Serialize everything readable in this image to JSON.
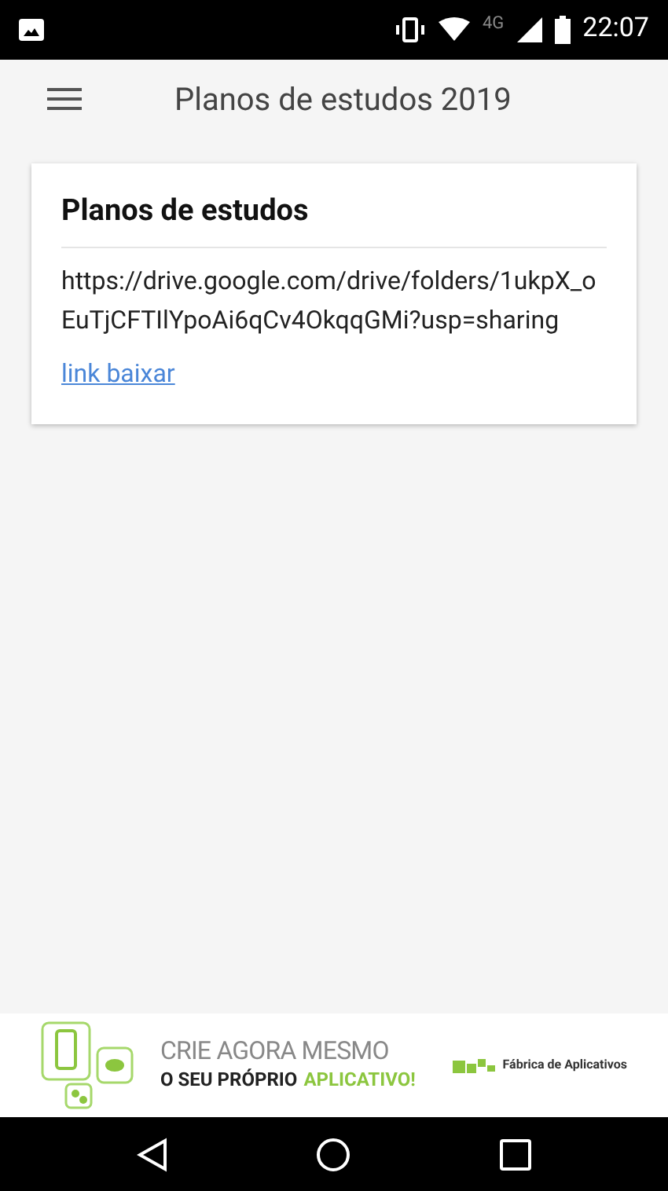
{
  "status_bar": {
    "network": "4G",
    "time": "22:07"
  },
  "app_bar": {
    "title": "Planos de estudos 2019"
  },
  "card": {
    "title": "Planos de estudos",
    "text": "https://drive.google.com/drive/folders/1ukpX_oEuTjCFTIlYpoAi6qCv4OkqqGMi?usp=sharing",
    "link": "link baixar"
  },
  "banner": {
    "headline": "CRIE AGORA MESMO",
    "tagline": [
      {
        "text": "O SEU PRÓPRIO",
        "kind": "plain"
      },
      {
        "text": "APLICATIVO!",
        "kind": "accent"
      }
    ],
    "brand": "Fábrica de Aplicativos"
  }
}
